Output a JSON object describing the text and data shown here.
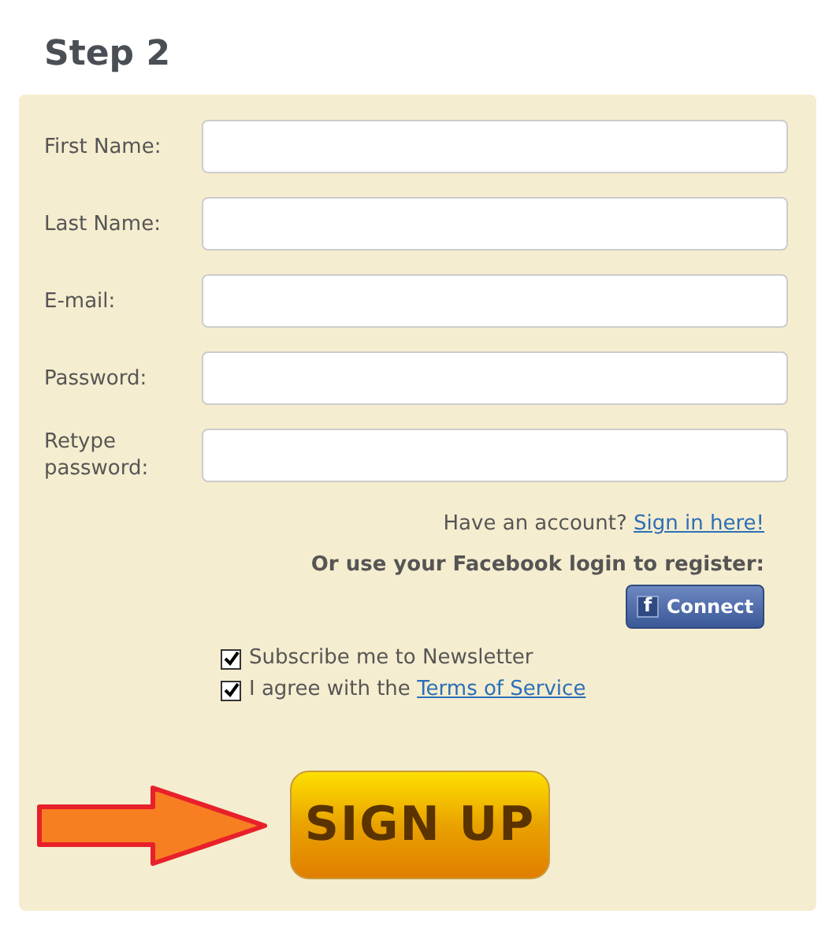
{
  "heading": "Step 2",
  "fields": [
    {
      "label": "First Name:"
    },
    {
      "label": "Last Name:"
    },
    {
      "label": "E-mail:"
    },
    {
      "label": "Password:"
    },
    {
      "label": "Retype password:"
    }
  ],
  "account_prompt": {
    "text": "Have an account?",
    "link": "Sign in here!"
  },
  "facebook": {
    "prompt": "Or use your Facebook login to register:",
    "button": "Connect",
    "logo": "f"
  },
  "checkboxes": [
    {
      "text": "Subscribe me to Newsletter",
      "checked": true
    },
    {
      "text": "I agree with the",
      "link": "Terms of Service",
      "checked": true
    }
  ],
  "submit": "SIGN UP"
}
